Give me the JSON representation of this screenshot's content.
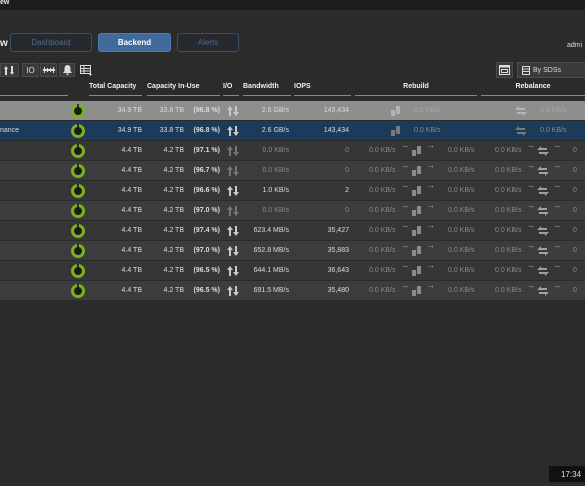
{
  "window_title_fragment": "ew",
  "view_title_fragment": "w",
  "nav": {
    "dashboard": "Dashboard",
    "backend": "Backend",
    "alerts": "Alerts"
  },
  "user_fragment": "admi",
  "toolbar": {
    "io_label": "IO",
    "group_by": "By SDSs"
  },
  "columns": {
    "total_capacity": "Total Capacity",
    "capacity_in_use": "Capacity In-Use",
    "io": "I/O",
    "bandwidth": "Bandwidth",
    "iops": "IOPS",
    "rebuild": "Rebuild",
    "rebalance": "Rebalance"
  },
  "rows": [
    {
      "name": "",
      "total": "34.9 TB",
      "in_use": "33.8 TB",
      "pct": "(96.8 %)",
      "bandwidth": "2.6 GB/s",
      "iops": "143,434",
      "reb1": "0.0 KB/s",
      "reb2": "",
      "rbl1": "0.0 KB/s",
      "rbl2": ""
    },
    {
      "name": "nance",
      "total": "34.9 TB",
      "in_use": "33.8 TB",
      "pct": "(96.8 %)",
      "bandwidth": "2.6 GB/s",
      "iops": "143,434",
      "reb1": "0.0 KB/s",
      "reb2": "",
      "rbl1": "0.0 KB/s",
      "rbl2": ""
    },
    {
      "name": "",
      "total": "4.4 TB",
      "in_use": "4.2 TB",
      "pct": "(97.1 %)",
      "bandwidth": "0.0 KB/s",
      "iops": "0",
      "reb1": "0.0 KB/s",
      "reb2": "0.0 KB/s",
      "rbl1": "0.0 KB/s",
      "rbl2": "0"
    },
    {
      "name": "",
      "total": "4.4 TB",
      "in_use": "4.2 TB",
      "pct": "(96.7 %)",
      "bandwidth": "0.0 KB/s",
      "iops": "0",
      "reb1": "0.0 KB/s",
      "reb2": "0.0 KB/s",
      "rbl1": "0.0 KB/s",
      "rbl2": "0"
    },
    {
      "name": "",
      "total": "4.4 TB",
      "in_use": "4.2 TB",
      "pct": "(96.6 %)",
      "bandwidth": "1.0 KB/s",
      "iops": "2",
      "reb1": "0.0 KB/s",
      "reb2": "0.0 KB/s",
      "rbl1": "0.0 KB/s",
      "rbl2": "0"
    },
    {
      "name": "",
      "total": "4.4 TB",
      "in_use": "4.2 TB",
      "pct": "(97.0 %)",
      "bandwidth": "0.0 KB/s",
      "iops": "0",
      "reb1": "0.0 KB/s",
      "reb2": "0.0 KB/s",
      "rbl1": "0.0 KB/s",
      "rbl2": "0"
    },
    {
      "name": "",
      "total": "4.4 TB",
      "in_use": "4.2 TB",
      "pct": "(97.4 %)",
      "bandwidth": "623.4 MB/s",
      "iops": "35,427",
      "reb1": "0.0 KB/s",
      "reb2": "0.0 KB/s",
      "rbl1": "0.0 KB/s",
      "rbl2": "0"
    },
    {
      "name": "",
      "total": "4.4 TB",
      "in_use": "4.2 TB",
      "pct": "(97.0 %)",
      "bandwidth": "652.8 MB/s",
      "iops": "35,883",
      "reb1": "0.0 KB/s",
      "reb2": "0.0 KB/s",
      "rbl1": "0.0 KB/s",
      "rbl2": "0"
    },
    {
      "name": "",
      "total": "4.4 TB",
      "in_use": "4.2 TB",
      "pct": "(96.5 %)",
      "bandwidth": "644.1 MB/s",
      "iops": "36,643",
      "reb1": "0.0 KB/s",
      "reb2": "0.0 KB/s",
      "rbl1": "0.0 KB/s",
      "rbl2": "0"
    },
    {
      "name": "",
      "total": "4.4 TB",
      "in_use": "4.2 TB",
      "pct": "(96.5 %)",
      "bandwidth": "691.5 MB/s",
      "iops": "35,480",
      "reb1": "0.0 KB/s",
      "reb2": "0.0 KB/s",
      "rbl1": "0.0 KB/s",
      "rbl2": "0"
    }
  ],
  "clock": "17:34",
  "colors": {
    "accent": "#3f6a9b",
    "ring": "#7ab21a",
    "selected_row": "#1c3a5a",
    "total_row": "#8e8e8e"
  }
}
